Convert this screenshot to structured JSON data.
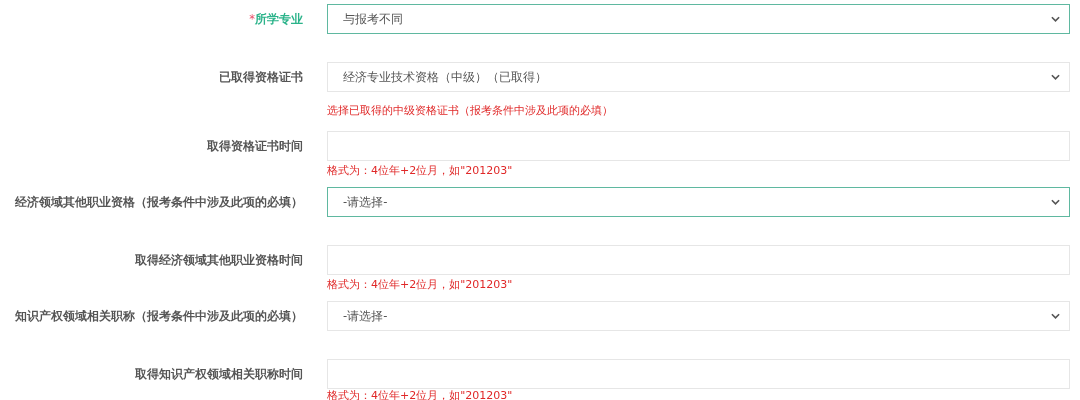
{
  "form": {
    "rows": [
      {
        "label": "所学专业",
        "required_mark": "*",
        "required": true,
        "kind": "select",
        "value": "与报考不同",
        "focused": true
      },
      {
        "label": "已取得资格证书",
        "required": false,
        "kind": "select",
        "value": "经济专业技术资格（中级）（已取得）",
        "focused": false,
        "hint": "选择已取得的中级资格证书（报考条件中涉及此项的必填）"
      },
      {
        "label": "取得资格证书时间",
        "required": false,
        "kind": "text",
        "focused": false,
        "hint": "格式为：4位年+2位月，如\"201203\""
      },
      {
        "label": "经济领域其他职业资格（报考条件中涉及此项的必填）",
        "required": false,
        "kind": "select",
        "value": "-请选择-",
        "focused": true
      },
      {
        "label": "取得经济领域其他职业资格时间",
        "required": false,
        "kind": "text",
        "focused": false,
        "hint": "格式为：4位年+2位月，如\"201203\""
      },
      {
        "label": "知识产权领域相关职称（报考条件中涉及此项的必填）",
        "required": false,
        "kind": "select",
        "value": "-请选择-",
        "focused": false
      },
      {
        "label": "取得知识产权领域相关职称时间",
        "required": false,
        "kind": "text",
        "focused": false,
        "hint": "格式为：4位年+2位月，如\"201203\""
      }
    ]
  }
}
